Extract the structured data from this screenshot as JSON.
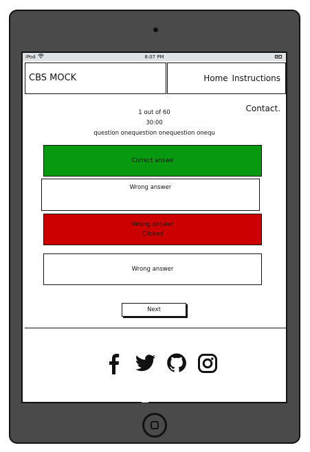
{
  "statusbar": {
    "carrier": "iPod",
    "time": "8:07 PM"
  },
  "header": {
    "brand": "CBS MOCK",
    "nav": [
      "Home",
      "Instructions",
      "Contact."
    ]
  },
  "quiz": {
    "counter": "1 out of 60",
    "timer": "30:00",
    "question": "question onequestion onequestion onequ",
    "answers": [
      {
        "line1": "Correct answe",
        "line2": "",
        "state": "correct",
        "color": "#07990f"
      },
      {
        "line1": "Wrong answer",
        "line2": "",
        "state": "neutral",
        "color": "#ffffff"
      },
      {
        "line1": "Wrong answer",
        "line2": "Clicked",
        "state": "wrong",
        "color": "#cc0000"
      },
      {
        "line1": "Wrong answer",
        "line2": "",
        "state": "neutral",
        "color": "#ffffff"
      }
    ],
    "next_label": "Next"
  },
  "footer": {
    "icons": [
      "facebook-icon",
      "twitter-icon",
      "github-icon",
      "instagram-icon"
    ]
  }
}
